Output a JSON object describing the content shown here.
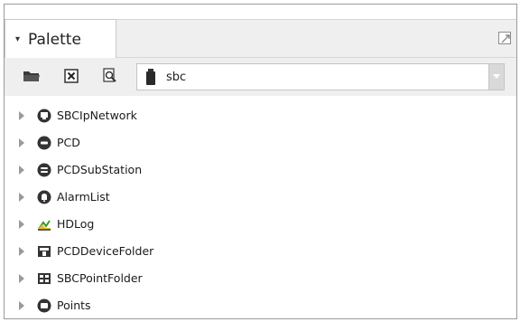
{
  "panel": {
    "title": "Palette",
    "collapse_icon": "caret-down-icon",
    "maximize_icon": "maximize-icon"
  },
  "toolbar": {
    "open_icon": "folder-open-icon",
    "close_icon": "close-box-icon",
    "find_icon": "find-icon",
    "module_selector": {
      "value": "sbc",
      "icon": "jar-icon"
    }
  },
  "tree": {
    "items": [
      {
        "label": "SBCIpNetwork",
        "icon": "network-icon"
      },
      {
        "label": "PCD",
        "icon": "device-icon"
      },
      {
        "label": "PCDSubStation",
        "icon": "substation-icon"
      },
      {
        "label": "AlarmList",
        "icon": "alarm-bell-icon"
      },
      {
        "label": "HDLog",
        "icon": "log-chart-icon"
      },
      {
        "label": "PCDDeviceFolder",
        "icon": "device-folder-icon"
      },
      {
        "label": "SBCPointFolder",
        "icon": "point-folder-icon"
      },
      {
        "label": "Points",
        "icon": "points-icon"
      }
    ]
  },
  "colors": {
    "header_bg": "#efefef",
    "icon_dark": "#333333",
    "hdlog_green": "#3a9a2a",
    "hdlog_yellow": "#e8c020"
  }
}
